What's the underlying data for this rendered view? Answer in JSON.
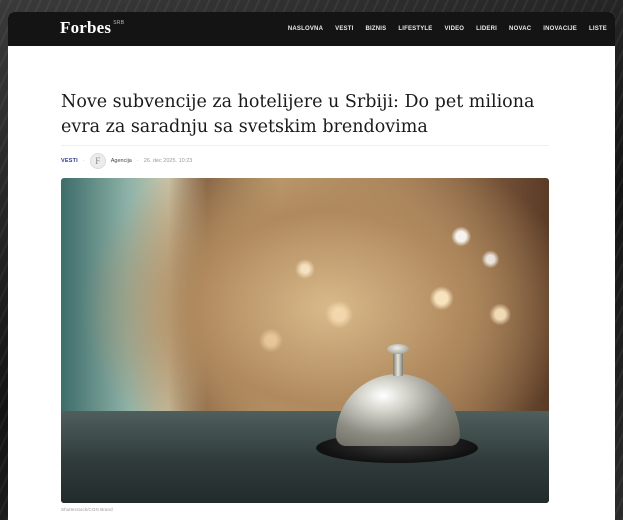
{
  "header": {
    "logo": "Forbes",
    "logo_sup": "SRB",
    "nav": [
      "NASLOVNA",
      "VESTI",
      "BIZNIS",
      "LIFESTYLE",
      "VIDEO",
      "LIDERI",
      "NOVAC",
      "INOVACIJE",
      "LISTE"
    ]
  },
  "article": {
    "title": "Nove subvencije za hotelijere u Srbiji: Do pet miliona evra za saradnju sa svetskim brendovima",
    "category": "VESTI",
    "author_initial": "F",
    "author": "Agencija",
    "date": "26. dec 2025. 10:23",
    "image_credit": "Shutterstock/CGN Brand",
    "image_alt": "Hotel reception bell on counter"
  }
}
